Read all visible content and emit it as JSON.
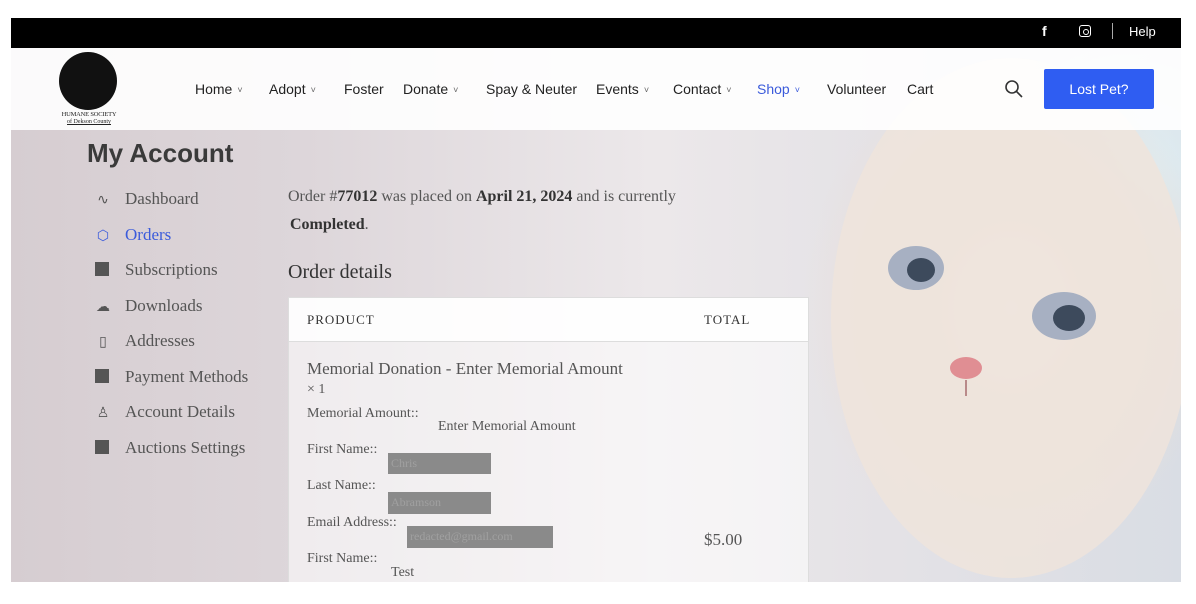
{
  "topbar": {
    "facebook": "f",
    "help": "Help"
  },
  "logo": {
    "line1": "HUMANE SOCIETY",
    "line2": "of Dekson County"
  },
  "nav": {
    "items": [
      {
        "label": "Home",
        "chevron": "˅"
      },
      {
        "label": "Adopt",
        "chevron": "˅"
      },
      {
        "label": "Foster"
      },
      {
        "label": "Donate",
        "chevron": "˅"
      },
      {
        "label": "Spay & Neuter"
      },
      {
        "label": "Events",
        "chevron": "˅"
      },
      {
        "label": "Contact",
        "chevron": "˅"
      },
      {
        "label": "Shop",
        "chevron": "˅",
        "active": true
      },
      {
        "label": "Volunteer"
      },
      {
        "label": "Cart"
      }
    ],
    "cta": "Lost Pet?"
  },
  "page_title": "My Account",
  "sidebar": {
    "items": [
      {
        "label": "Dashboard",
        "icon": "activity-icon"
      },
      {
        "label": "Orders",
        "icon": "box-icon",
        "active": true
      },
      {
        "label": "Subscriptions",
        "icon": "square-icon"
      },
      {
        "label": "Downloads",
        "icon": "cloud-download-icon"
      },
      {
        "label": "Addresses",
        "icon": "map-icon"
      },
      {
        "label": "Payment Methods",
        "icon": "square-icon"
      },
      {
        "label": "Account Details",
        "icon": "user-icon"
      },
      {
        "label": "Auctions Settings",
        "icon": "square-icon"
      }
    ]
  },
  "order": {
    "prefix": "Order #",
    "number": "77012",
    "placed_text": "was placed on",
    "date": "April 21, 2024",
    "currently_text": "and is currently",
    "status": "Completed",
    "status_suffix": "."
  },
  "order_details_title": "Order details",
  "table": {
    "col_product": "PRODUCT",
    "col_total": "TOTAL",
    "product_name": "Memorial Donation - Enter Memorial Amount",
    "quantity": "× 1",
    "memorial_amount_label": "Memorial Amount::",
    "memorial_amount_value": "Enter Memorial Amount",
    "first_name_label": "First Name::",
    "first_name_value": "Chris",
    "last_name_label": "Last Name::",
    "last_name_value": "Abramson",
    "email_label": "Email Address::",
    "email_value": "redacted@gmail.com",
    "first_name2_label": "First Name::",
    "first_name2_value": "Test",
    "line_total": "$5.00"
  },
  "colors": {
    "accent": "#3b5bdb",
    "cta": "#2f5df2",
    "topbar": "#000000"
  }
}
